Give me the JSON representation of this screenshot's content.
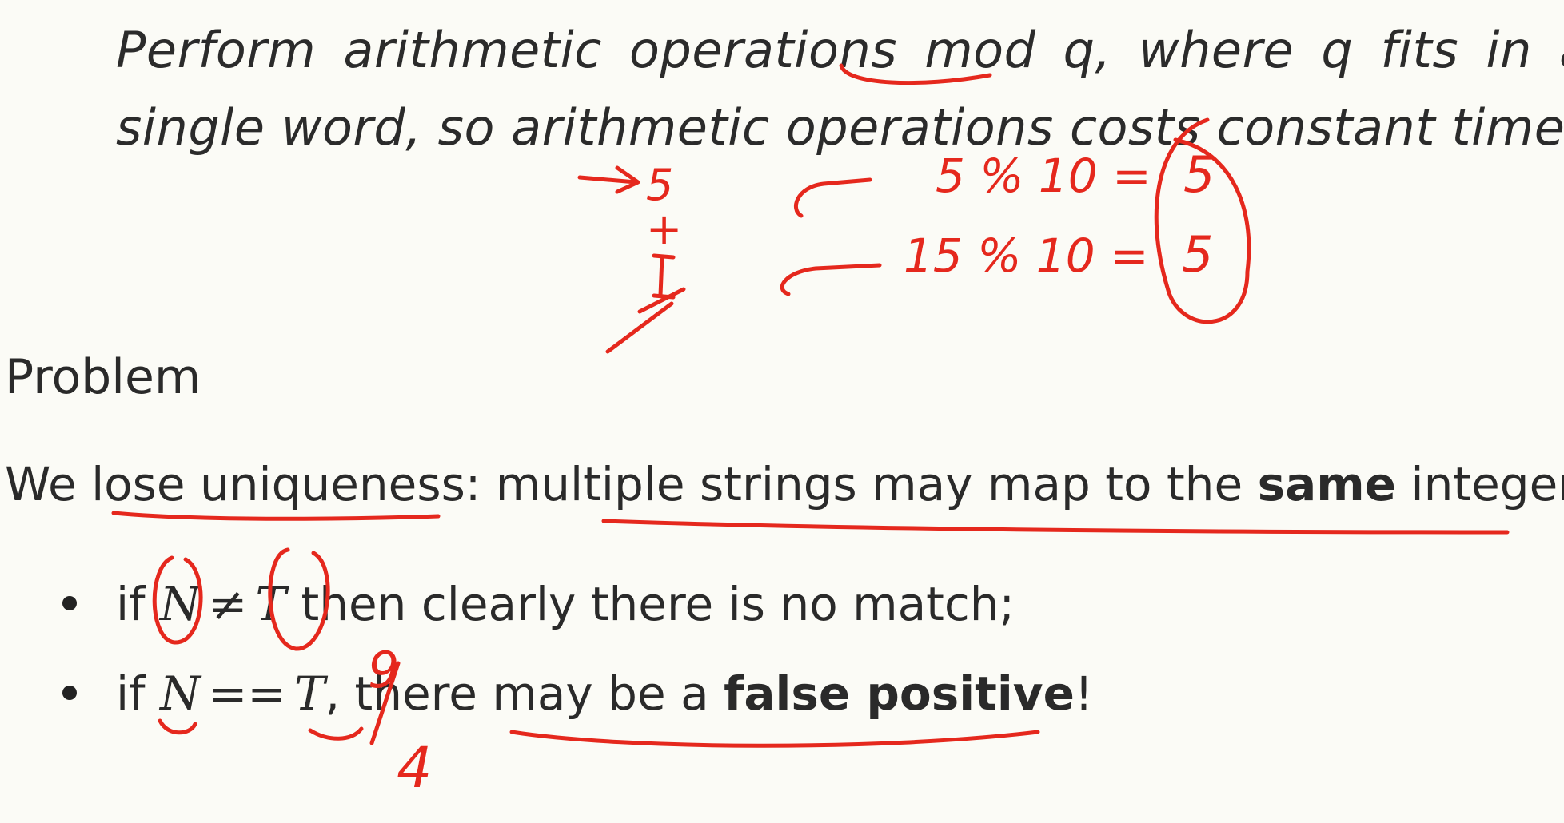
{
  "intro": {
    "line1": "Perform arithmetic operations mod q, where q fits in a",
    "line2": "single word, so arithmetic operations costs constant time."
  },
  "heading": "Problem",
  "statement": {
    "part1": "We lose uniqueness: multiple strings may map to the ",
    "bold": "same",
    "part2": " integer."
  },
  "bullets": [
    {
      "prefix": "if ",
      "var1": "N",
      "operator": "≠",
      "var2": "T",
      "suffix": " then clearly there is no match;"
    },
    {
      "prefix": "if ",
      "var1": "N",
      "operator": "==",
      "var2": "T",
      "middle": ", there may be a ",
      "bold": "false positive",
      "suffix": "!"
    }
  ],
  "annotations": {
    "num_five": "5",
    "plus_sign": "+",
    "calc1": "5 % 10 =",
    "calc2": "15 % 10 =",
    "result1": "5",
    "result2": "5",
    "num_nine": "9",
    "num_four": "4",
    "ink_color": "#e5281d"
  }
}
